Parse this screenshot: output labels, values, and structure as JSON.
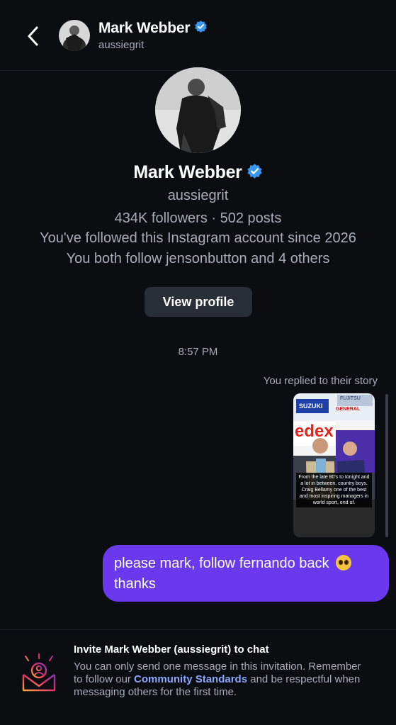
{
  "header": {
    "name": "Mark Webber",
    "handle": "aussiegrit"
  },
  "profile": {
    "name": "Mark Webber",
    "handle": "aussiegrit",
    "stats": "434K followers · 502 posts",
    "since": "You've followed this Instagram account since 2026",
    "mutual": "You both follow jensonbutton and 4 others",
    "view_profile_label": "View profile"
  },
  "thread": {
    "timestamp": "8:57 PM",
    "replied_label": "You replied to their story",
    "story_sponsor_1": "SUZUKI",
    "story_sponsor_2": "FUJITSU",
    "story_sponsor_3": "GENERAL",
    "story_banner": "edex",
    "story_caption": "From the late 80's to tonight and a lot in between, country boys. Craig Bellamy one of the best and most inspiring managers in world sport, end of.",
    "message_line1": "please mark, follow fernando back",
    "message_line2": "thanks"
  },
  "invite": {
    "title": "Invite Mark Webber (aussiegrit) to chat",
    "body_before": "You can only send one message in this invitation. Remember to follow our ",
    "link": "Community Standards",
    "body_after": " and be respectful when messaging others for the first time."
  },
  "colors": {
    "background": "#0b0d10",
    "bubble": "#6a39ee",
    "verified": "#3897f0",
    "link": "#8aa8ff",
    "button": "#2a2e35"
  },
  "icons": [
    "back-arrow-icon",
    "verified-badge-icon",
    "invite-envelope-icon"
  ]
}
